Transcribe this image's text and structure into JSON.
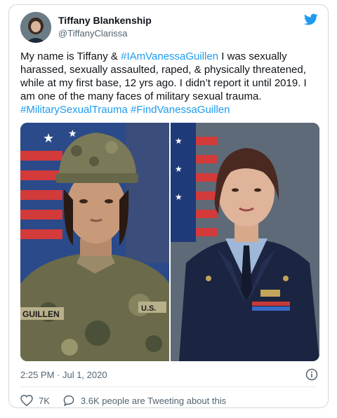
{
  "author": {
    "name": "Tiffany Blankenship",
    "handle": "@TiffanyClarissa"
  },
  "tweet": {
    "part1": "My name is Tiffany & ",
    "tag1": "#IAmVanessaGuillen",
    "part2": " I was sexually harassed, sexually assaulted, raped, & physically threatened, while at my first base, 12 yrs ago. I didn’t report it until 2019. I am one of the many faces of military sexual trauma. ",
    "tag2": "#MilitarySexualTrauma",
    "tag3": "#FindVanessaGuillen"
  },
  "media": {
    "left_nametape": "GUILLEN",
    "left_us": "U.S."
  },
  "meta": {
    "timestamp": "2:25 PM · Jul 1, 2020"
  },
  "actions": {
    "likes": "7K",
    "discussion": "3.6K people are Tweeting about this"
  },
  "colors": {
    "accent": "#1d9bf0",
    "text": "#0f1419",
    "muted": "#536471",
    "border": "#cfd9de"
  },
  "icons": [
    "avatar",
    "twitter-bird-icon",
    "info-icon",
    "heart-icon",
    "reply-bubble-icon"
  ]
}
